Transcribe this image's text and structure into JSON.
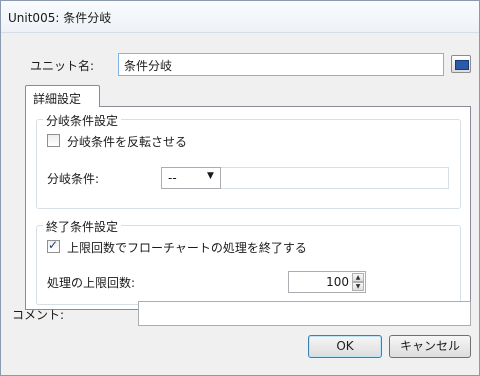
{
  "window": {
    "title": "Unit005: 条件分岐"
  },
  "unit_name": {
    "label": "ユニット名:",
    "value": "条件分岐",
    "keyboard_icon": "keyboard-icon"
  },
  "tabs": [
    {
      "label": "詳細設定",
      "selected": true
    }
  ],
  "branch_group": {
    "title": "分岐条件設定",
    "invert_checkbox": {
      "label": "分岐条件を反転させる",
      "checked": false
    },
    "condition": {
      "label": "分岐条件:",
      "value": "--"
    }
  },
  "end_group": {
    "title": "終了条件設定",
    "limit_checkbox": {
      "label": "上限回数でフローチャートの処理を終了する",
      "checked": true
    },
    "max_count": {
      "label": "処理の上限回数:",
      "value": "100"
    }
  },
  "comment": {
    "label": "コメント:",
    "value": ""
  },
  "buttons": {
    "ok": "OK",
    "cancel": "キャンセル"
  }
}
